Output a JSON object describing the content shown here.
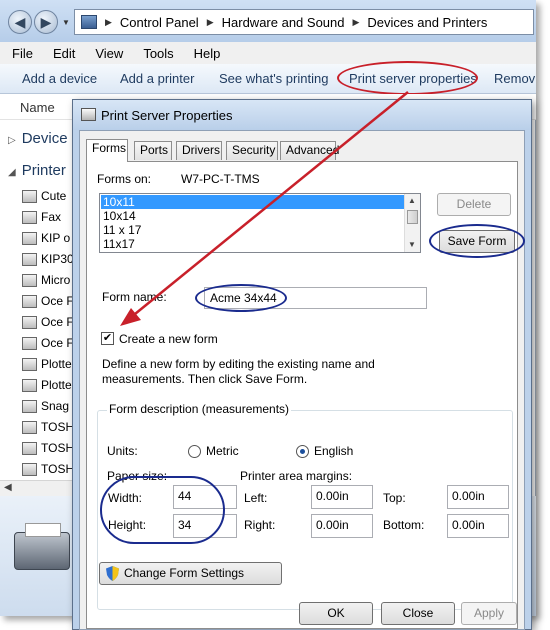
{
  "explorer": {
    "breadcrumb": [
      "Control Panel",
      "Hardware and Sound",
      "Devices and Printers"
    ],
    "menu": [
      "File",
      "Edit",
      "View",
      "Tools",
      "Help"
    ],
    "commands": {
      "add_device": "Add a device",
      "add_printer": "Add a printer",
      "see_printing": "See what's printing",
      "server_properties": "Print server properties",
      "remove": "Remov"
    },
    "column_name": "Name",
    "groups": {
      "devices": "Device",
      "printers": "Printer"
    },
    "items": [
      "Cute",
      "Fax",
      "KIP o",
      "KIP30",
      "Micro",
      "Oce F",
      "Oce F",
      "Oce F",
      "Plotte",
      "Plotte",
      "Snag",
      "TOSH",
      "TOSH",
      "TOSH"
    ]
  },
  "dialog": {
    "title": "Print Server Properties",
    "tabs": [
      "Forms",
      "Ports",
      "Drivers",
      "Security",
      "Advanced"
    ],
    "forms_on_label": "Forms on:",
    "server_name": "W7-PC-T-TMS",
    "forms_list": [
      "10x11",
      "10x14",
      "11 x 17",
      "11x17"
    ],
    "selected_index": 0,
    "delete_label": "Delete",
    "save_form_label": "Save Form",
    "form_name_label": "Form name:",
    "form_name_value": "Acme 34x44",
    "create_new_label": "Create a new form",
    "create_new_checked": true,
    "define_text": "Define a new form by editing the existing name and measurements. Then click Save Form.",
    "description_legend": "Form description (measurements)",
    "units_label": "Units:",
    "metric_label": "Metric",
    "english_label": "English",
    "units_selected": "English",
    "paper_size_label": "Paper size:",
    "margins_label": "Printer area margins:",
    "width_label": "Width:",
    "width_value": "44",
    "height_label": "Height:",
    "height_value": "34",
    "left_label": "Left:",
    "left_value": "0.00in",
    "right_label": "Right:",
    "right_value": "0.00in",
    "top_label": "Top:",
    "top_value": "0.00in",
    "bottom_label": "Bottom:",
    "bottom_value": "0.00in",
    "change_settings_label": "Change Form Settings",
    "ok_label": "OK",
    "close_label": "Close",
    "apply_label": "Apply"
  },
  "colors": {
    "annotation_red": "#c8202a",
    "annotation_blue": "#1a2b8e",
    "selection_blue": "#3399ff"
  }
}
